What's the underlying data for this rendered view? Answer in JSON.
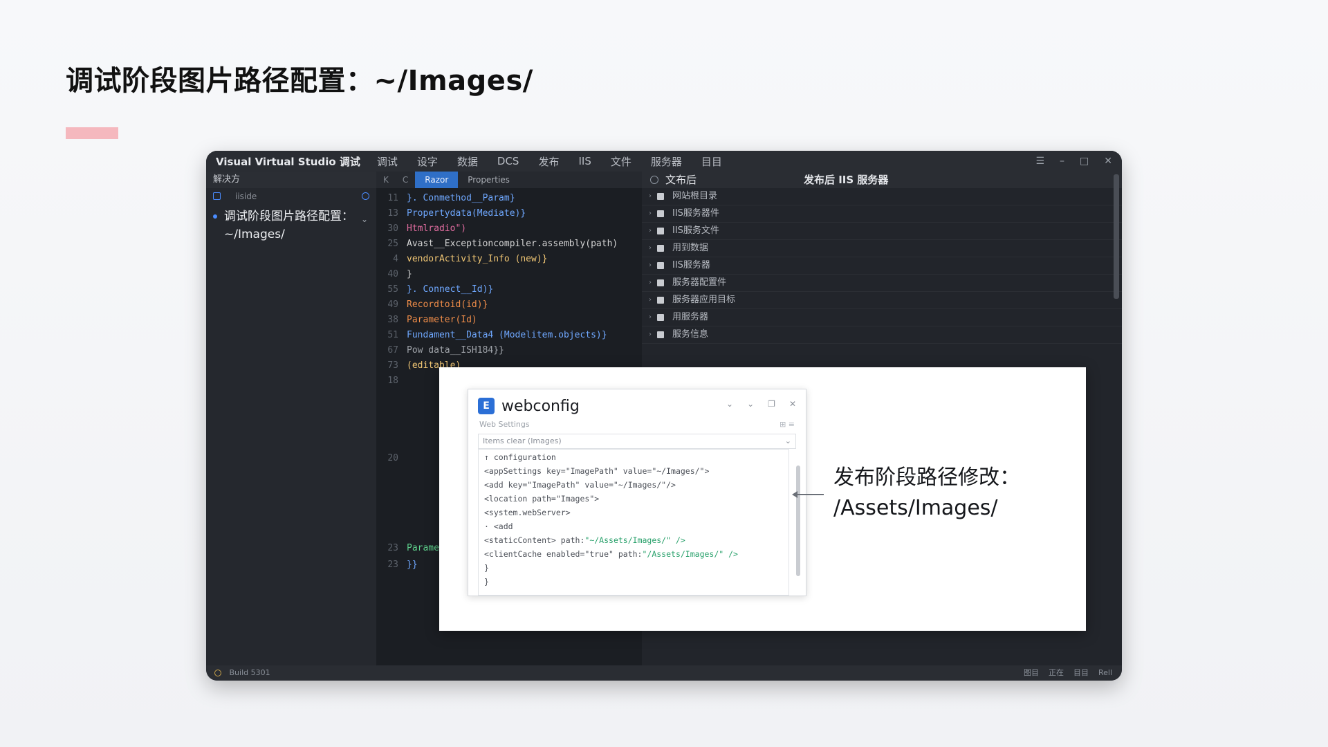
{
  "slide": {
    "title": "调试阶段图片路径配置：~/Images/"
  },
  "window": {
    "app_title": "Visual Virtual Studio 调试",
    "menu": [
      "调试",
      "设字",
      "数据",
      "DCS",
      "发布",
      "IIS",
      "文件",
      "服务器",
      "目目"
    ]
  },
  "sidebar": {
    "header": "解决方",
    "search_text": "iiside",
    "node_label": "调试阶段图片路径配置：",
    "node_path": "~/Images/"
  },
  "editor": {
    "toolbar_icons": [
      "K",
      "C"
    ],
    "tabs": [
      "Razor",
      "Properties"
    ],
    "lines": [
      {
        "n": "11",
        "t": "}. Conmethod__Param}",
        "c": "#6fa8ff"
      },
      {
        "n": "13",
        "t": "  Propertydata(Mediate)}",
        "c": "#6fa8ff"
      },
      {
        "n": "30",
        "t": "  Htmlradio\")",
        "c": "#e06c9f"
      },
      {
        "n": "25",
        "t": "  Avast__Exceptioncompiler.assembly(path)",
        "c": "#d4d4d4"
      },
      {
        "n": "4",
        "t": "   vendorActivity_Info (new)}",
        "c": "#f0c674"
      },
      {
        "n": "40",
        "t": "  }",
        "c": "#d4d4d4"
      },
      {
        "n": "55",
        "t": "}. Connect__Id)}",
        "c": "#6fa8ff"
      },
      {
        "n": "49",
        "t": "  Recordtoid(id)}",
        "c": "#f08d49"
      },
      {
        "n": "38",
        "t": "  Parameter(Id)",
        "c": "#f08d49"
      },
      {
        "n": "51",
        "t": "  Fundament__Data4 (Modelitem.objects)}",
        "c": "#6fa8ff"
      },
      {
        "n": "67",
        "t": "  Pow data__ISH184}}",
        "c": "#a0a4aa"
      },
      {
        "n": "73",
        "t": "  (editable)",
        "c": "#f0c674"
      },
      {
        "n": "18",
        "t": "  ",
        "c": "#d4d4d4"
      },
      {
        "n": "20",
        "t": "  ",
        "c": "#d4d4d4"
      },
      {
        "n": "23",
        "t": "  Parameter: Aprectual_in)}",
        "c": "#5fd38d"
      },
      {
        "n": "23",
        "t": "}}",
        "c": "#6fa8ff"
      }
    ]
  },
  "properties": {
    "header_left": "文布后",
    "header_right": "发布后 IIS 服务器",
    "rows": [
      "网站根目录",
      "IIS服务器件",
      "IIS服务文件",
      "用到数据",
      "IIS服务器",
      "服务器配置件",
      "服务器应用目标",
      "用服务器",
      "服务信息"
    ]
  },
  "statusbar": {
    "left": "Build 5301",
    "right": [
      "图目",
      "正在",
      "目目",
      "Rell"
    ]
  },
  "dialog": {
    "title": "webconfig",
    "logo": "E",
    "subtitle": "Web Settings",
    "subtitle_right": "⊞ ≡",
    "combo": "Items clear (Images)",
    "xml_lines": [
      {
        "t": "↑ configuration",
        "g": ""
      },
      {
        "t": "  <appSettings key=\"ImagePath\" value=\"~/Images/\">",
        "g": ""
      },
      {
        "t": "    <add key=\"ImagePath\" value=\"~/Images/\"/>",
        "g": ""
      },
      {
        "t": "    <location path=\"Images\">",
        "g": ""
      },
      {
        "t": "    <system.webServer>",
        "g": ""
      },
      {
        "t": "     · <add",
        "g": ""
      },
      {
        "t": "      <staticContent>  path:",
        "g": "\"~/Assets/Images/\" />"
      },
      {
        "t": "      <clientCache enabled=\"true\" path:",
        "g": "\"/Assets/Images/\" />"
      },
      {
        "t": "    }",
        "g": ""
      },
      {
        "t": "  }",
        "g": ""
      }
    ]
  },
  "callout": {
    "line1": "发布阶段路径修改：",
    "line2": "/Assets/Images/"
  },
  "colors": {
    "accent": "#f5b8be",
    "active_tab": "#2f6fc7",
    "window_bg": "#1f2228"
  }
}
